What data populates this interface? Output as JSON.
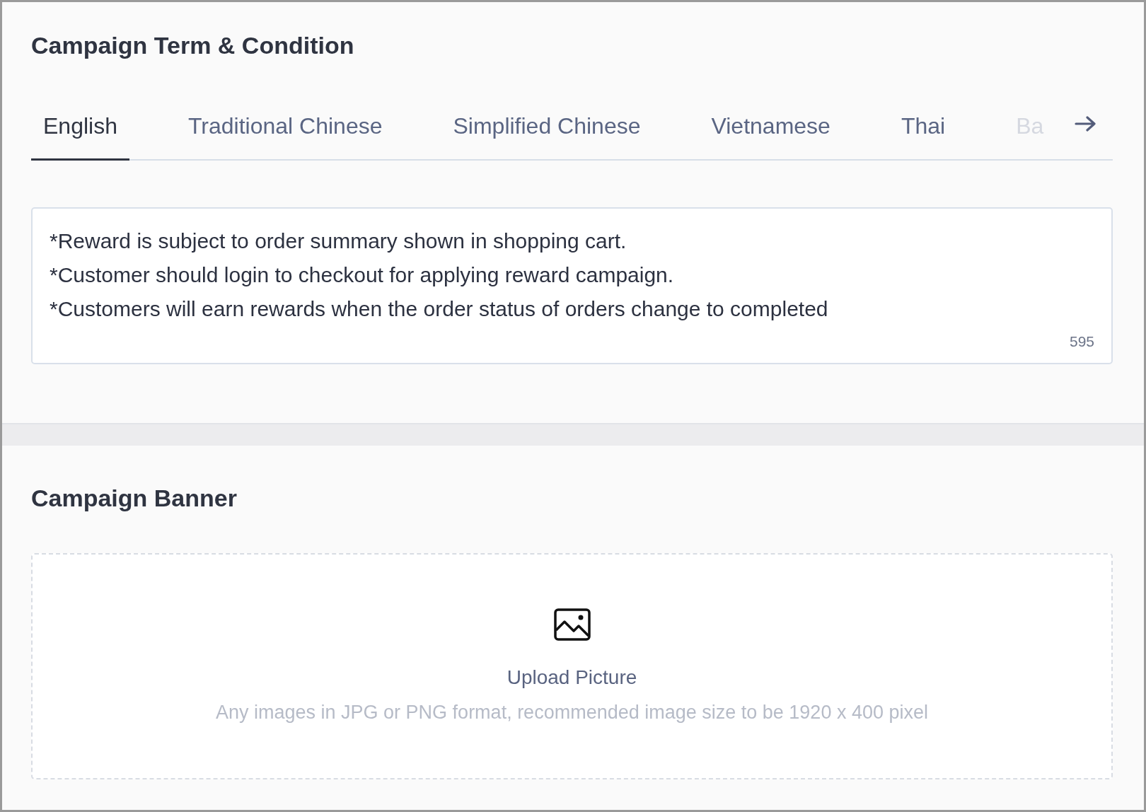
{
  "terms_section": {
    "title": "Campaign Term & Condition",
    "tabs": [
      {
        "label": "English",
        "selected": true,
        "faded": false
      },
      {
        "label": "Traditional Chinese",
        "selected": false,
        "faded": false
      },
      {
        "label": "Simplified Chinese",
        "selected": false,
        "faded": false
      },
      {
        "label": "Vietnamese",
        "selected": false,
        "faded": false
      },
      {
        "label": "Thai",
        "selected": false,
        "faded": false
      },
      {
        "label": "Ba",
        "selected": false,
        "faded": true
      }
    ],
    "terms_field": {
      "lines": [
        "*Reward is subject to order summary shown in shopping cart.",
        "*Customer should login to checkout for applying reward campaign.",
        "*Customers will earn rewards when the order status of orders change to completed"
      ],
      "counter": "595"
    }
  },
  "banner_section": {
    "title": "Campaign Banner",
    "upload": {
      "label": "Upload Picture",
      "hint": "Any images in JPG or PNG format, recommended image size to be 1920 x 400 pixel"
    }
  }
}
